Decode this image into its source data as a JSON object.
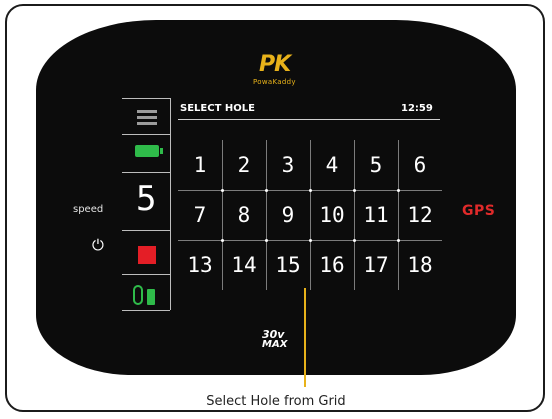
{
  "brand": {
    "logo_text": "PK",
    "logo_subtext": "PowaKaddy"
  },
  "sidebar": {
    "menu_icon": "hamburger-icon",
    "battery_icon": "battery-full-icon",
    "speed_value": "5",
    "speed_label": "speed",
    "power_icon": "power-icon",
    "stop_icon": "stop-icon",
    "remote_icon": "remote-battery-icon"
  },
  "screen": {
    "title": "SELECT HOLE",
    "time": "12:59",
    "holes": [
      "1",
      "2",
      "3",
      "4",
      "5",
      "6",
      "7",
      "8",
      "9",
      "10",
      "11",
      "12",
      "13",
      "14",
      "15",
      "16",
      "17",
      "18"
    ]
  },
  "gps_label": "GPS",
  "model": {
    "line1": "30v",
    "line2": "MAX"
  },
  "caption": "Select Hole from Grid",
  "colors": {
    "accent": "#e8b21a",
    "gps": "#e02a2a",
    "battery": "#2fbb4a",
    "stop": "#e41e26",
    "device": "#0c0c0c"
  }
}
